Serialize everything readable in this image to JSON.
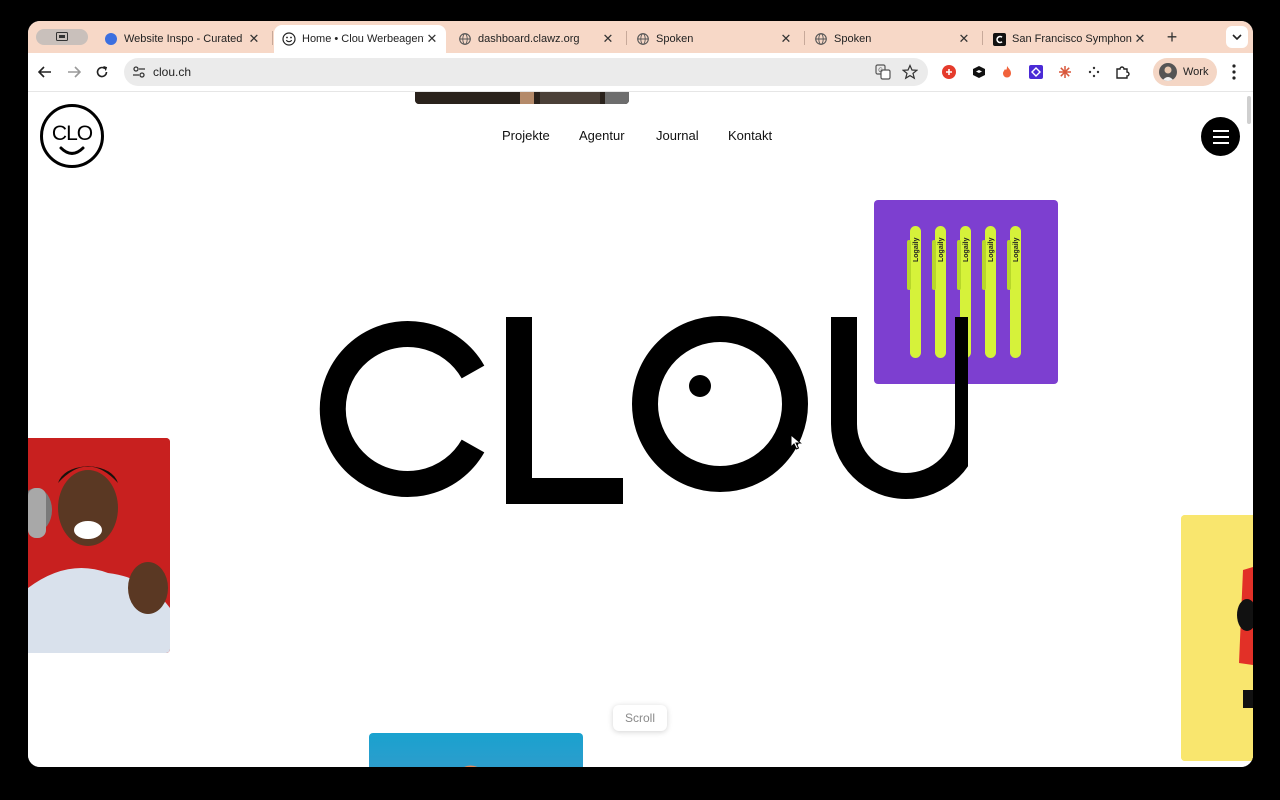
{
  "browser": {
    "tabs": [
      {
        "title": "Website Inspo - Curated an",
        "favicon": "blue-dot-icon",
        "active": false
      },
      {
        "title": "Home • Clou Werbeagentur",
        "favicon": "smiley-icon",
        "active": true
      },
      {
        "title": "dashboard.clawz.org",
        "favicon": "globe-icon",
        "active": false
      },
      {
        "title": "Spoken",
        "favicon": "globe-icon",
        "active": false
      },
      {
        "title": "Spoken",
        "favicon": "globe-icon",
        "active": false
      },
      {
        "title": "San Francisco Symphony |",
        "favicon": "c-logo-icon",
        "active": false
      }
    ],
    "url": "clou.ch",
    "profile_label": "Work",
    "accent_colors": {
      "tabbar": "#f7d8c7",
      "profile": "#f4d6c5"
    }
  },
  "site": {
    "nav": [
      {
        "label": "Projekte"
      },
      {
        "label": "Agentur"
      },
      {
        "label": "Journal"
      },
      {
        "label": "Kontakt"
      }
    ],
    "logo_text": "CLO",
    "hero_word": "CLOU",
    "scroll_label": "Scroll",
    "pen_text": "Logaily",
    "colors": {
      "purple": "#7d3fd0",
      "red": "#c8201f",
      "yellow": "#f9e66e",
      "lime": "#d6f23a",
      "blue": "#1aa2cf"
    }
  }
}
